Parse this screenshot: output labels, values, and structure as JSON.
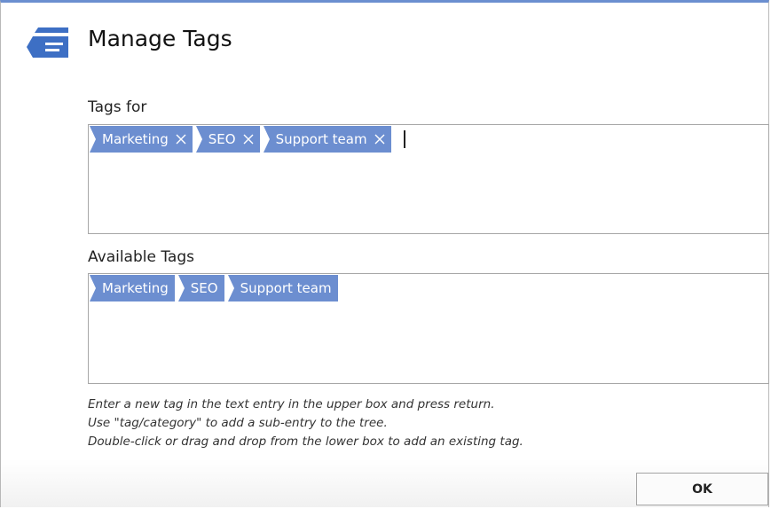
{
  "dialog": {
    "title": "Manage Tags",
    "icon": "manage-tags-logo-icon",
    "accent_color": "#6b8fd0",
    "tag_color": "#6c8ed0"
  },
  "tags_for": {
    "label": "Tags for",
    "tags": [
      {
        "label": "Marketing"
      },
      {
        "label": "SEO"
      },
      {
        "label": "Support team"
      }
    ],
    "remove_icon": "close-icon"
  },
  "available_tags": {
    "label": "Available Tags",
    "tags": [
      {
        "label": "Marketing"
      },
      {
        "label": "SEO"
      },
      {
        "label": "Support team"
      }
    ]
  },
  "hints": [
    "Enter a new tag in the text entry in the upper box and press return.",
    "Use \"tag/category\" to add a sub-entry to the tree.",
    "Double-click or drag and drop from the lower box to add an existing tag."
  ],
  "buttons": {
    "ok_label": "OK"
  }
}
